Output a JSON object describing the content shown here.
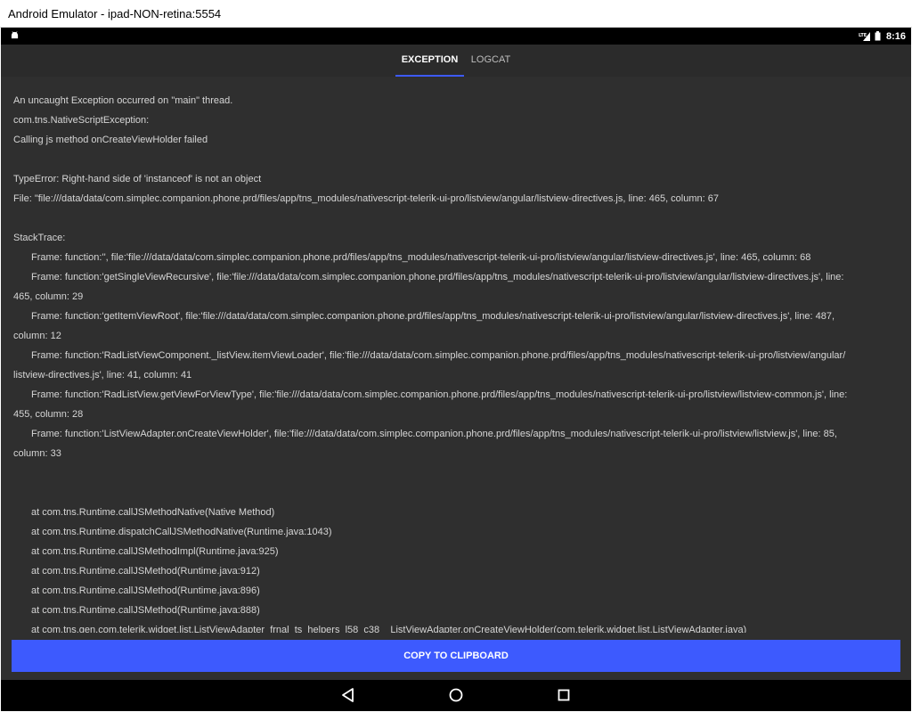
{
  "window": {
    "title": "Android Emulator - ipad-NON-retina:5554"
  },
  "statusbar": {
    "time": "8:16",
    "network_label": "LTE",
    "left_icon": "android-icon"
  },
  "tabs": [
    {
      "label": "EXCEPTION",
      "active": true
    },
    {
      "label": "LOGCAT",
      "active": false
    }
  ],
  "message": {
    "line1": "An uncaught Exception occurred on \"main\" thread.",
    "line2": "com.tns.NativeScriptException:",
    "line3": "Calling js method onCreateViewHolder failed",
    "error": "TypeError: Right-hand side of 'instanceof' is not an object",
    "file": "File: \"file:///data/data/com.simplec.companion.phone.prd/files/app/tns_modules/nativescript-telerik-ui-pro/listview/angular/listview-directives.js, line: 465, column: 67"
  },
  "stacktrace": {
    "header": "StackTrace:",
    "frames": [
      {
        "a": "Frame: function:'', file:'file:///data/data/com.simplec.companion.phone.prd/files/app/tns_modules/nativescript-telerik-ui-pro/listview/angular/listview-directives.js', line: 465, column: 68",
        "b": ""
      },
      {
        "a": "Frame: function:'getSingleViewRecursive', file:'file:///data/data/com.simplec.companion.phone.prd/files/app/tns_modules/nativescript-telerik-ui-pro/listview/angular/listview-directives.js', line:",
        "b": "465, column: 29"
      },
      {
        "a": "Frame: function:'getItemViewRoot', file:'file:///data/data/com.simplec.companion.phone.prd/files/app/tns_modules/nativescript-telerik-ui-pro/listview/angular/listview-directives.js', line: 487,",
        "b": "column: 12"
      },
      {
        "a": "Frame: function:'RadListViewComponent._listView.itemViewLoader', file:'file:///data/data/com.simplec.companion.phone.prd/files/app/tns_modules/nativescript-telerik-ui-pro/listview/angular/",
        "b": "listview-directives.js', line: 41, column: 41"
      },
      {
        "a": "Frame: function:'RadListView.getViewForViewType', file:'file:///data/data/com.simplec.companion.phone.prd/files/app/tns_modules/nativescript-telerik-ui-pro/listview/listview-common.js', line:",
        "b": "455, column: 28"
      },
      {
        "a": "Frame: function:'ListViewAdapter.onCreateViewHolder', file:'file:///data/data/com.simplec.companion.phone.prd/files/app/tns_modules/nativescript-telerik-ui-pro/listview/listview.js', line: 85,",
        "b": "column: 33"
      }
    ]
  },
  "java_stack": [
    "at com.tns.Runtime.callJSMethodNative(Native Method)",
    "at com.tns.Runtime.dispatchCallJSMethodNative(Runtime.java:1043)",
    "at com.tns.Runtime.callJSMethodImpl(Runtime.java:925)",
    "at com.tns.Runtime.callJSMethod(Runtime.java:912)",
    "at com.tns.Runtime.callJSMethod(Runtime.java:896)",
    "at com.tns.Runtime.callJSMethod(Runtime.java:888)",
    "at com.tns.gen.com.telerik.widget.list.ListViewAdapter_frnal_ts_helpers_l58_c38__ListViewAdapter.onCreateViewHolder(com.telerik.widget.list.ListViewAdapter.java)"
  ],
  "copy_button": {
    "label": "COPY TO CLIPBOARD"
  },
  "navigation": {
    "back_icon": "back-icon",
    "home_icon": "home-icon",
    "recents_icon": "recents-icon"
  },
  "colors": {
    "accent": "#3d5afe",
    "background": "#2f2f2f",
    "text": "#d6d6d6"
  }
}
